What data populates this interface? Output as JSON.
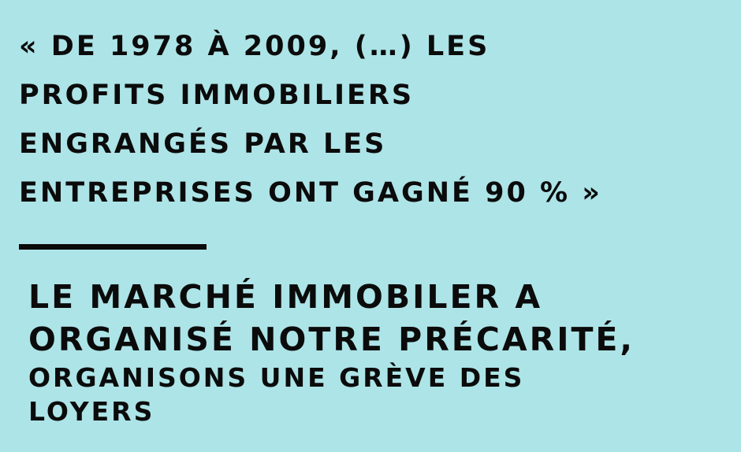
{
  "quote": {
    "lines": [
      "« DE 1978 À 2009, (…) LES",
      "PROFITS IMMOBILIERS",
      "ENGRANGÉS PAR LES",
      "ENTREPRISES ONT GAGNÉ 90 % »"
    ]
  },
  "slogan": {
    "big_lines": [
      "LE MARCHÉ IMMOBILER A",
      "ORGANISÉ NOTRE PRÉCARITÉ,"
    ],
    "small_lines": [
      "ORGANISONS UNE GRÈVE DES",
      "LOYERS"
    ]
  },
  "colors": {
    "background": "#ADE4E7",
    "text": "#0B0B0B"
  }
}
